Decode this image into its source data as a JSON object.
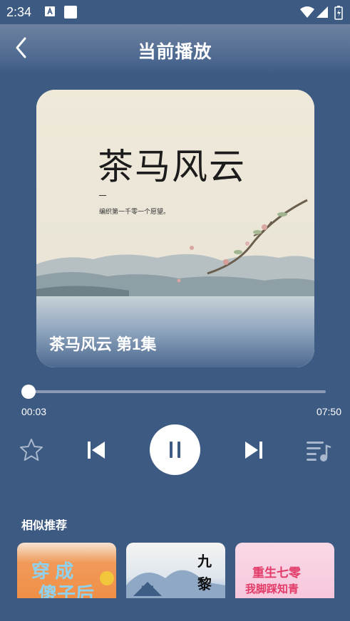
{
  "status": {
    "time": "2:34"
  },
  "header": {
    "title": "当前播放"
  },
  "cover": {
    "title": "茶马风云",
    "subtitle": "编织第一千零一个愿望。",
    "caption": "茶马风云 第1集"
  },
  "player": {
    "current_time": "00:03",
    "total_time": "07:50",
    "progress": 0.006
  },
  "recommend": {
    "heading": "相似推荐",
    "items": [
      {
        "text_line1": "穿 成",
        "text_line2": "傻子后"
      },
      {
        "text_line1": "九",
        "text_line2": "黎"
      },
      {
        "text_line1": "重生七零",
        "text_line2": "我脚踩知青"
      }
    ]
  },
  "colors": {
    "background": "#3d5a82",
    "accent": "#ffffff"
  }
}
